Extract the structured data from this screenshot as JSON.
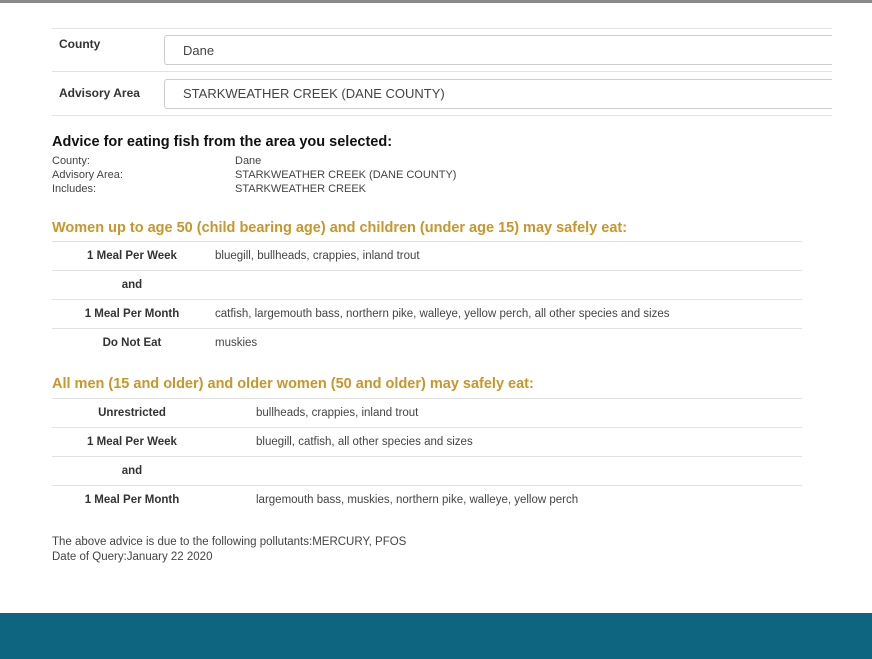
{
  "form": {
    "county_label": "County",
    "county_value": "Dane",
    "area_label": "Advisory Area",
    "area_value": "STARKWEATHER CREEK (DANE COUNTY)"
  },
  "advice": {
    "title": "Advice for eating fish from the area you selected:",
    "meta": [
      {
        "key": "County:",
        "value": "Dane"
      },
      {
        "key": "Advisory Area:",
        "value": "STARKWEATHER CREEK (DANE COUNTY)"
      },
      {
        "key": "Includes:",
        "value": "STARKWEATHER CREEK"
      }
    ]
  },
  "groups": [
    {
      "heading": "Women up to age 50 (child bearing age) and children (under age 15) may safely eat:",
      "rows": [
        {
          "frequency": "1 Meal Per Week",
          "species": "bluegill, bullheads, crappies, inland trout"
        },
        {
          "frequency": "and",
          "species": ""
        },
        {
          "frequency": "1 Meal Per Month",
          "species": "catfish, largemouth bass, northern pike, walleye, yellow perch, all other species and sizes"
        },
        {
          "frequency": "Do Not Eat",
          "species": "muskies"
        }
      ]
    },
    {
      "heading": "All men (15 and older) and older women (50 and older) may safely eat:",
      "rows": [
        {
          "frequency": "Unrestricted",
          "species": "bullheads, crappies, inland trout"
        },
        {
          "frequency": "1 Meal Per Week",
          "species": "bluegill, catfish, all other species and sizes"
        },
        {
          "frequency": "and",
          "species": ""
        },
        {
          "frequency": "1 Meal Per Month",
          "species": "largemouth bass, muskies, northern pike, walleye, yellow perch"
        }
      ]
    }
  ],
  "footer": {
    "pollutants": "The above advice is due to the following pollutants:MERCURY, PFOS",
    "query_date": "Date of Query:January 22 2020"
  },
  "colors": {
    "accent": "#c8962a",
    "footer_bar": "#0d6580"
  }
}
